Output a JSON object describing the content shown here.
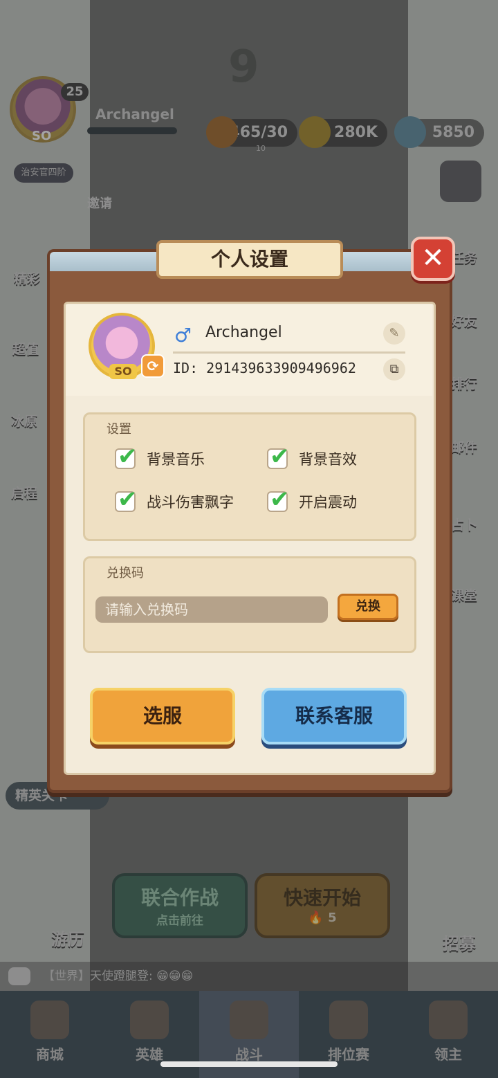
{
  "hud": {
    "level": "25",
    "player_name": "Archangel",
    "avatar_badge": "SO",
    "rank": "治安官四阶",
    "stamina": "465/30",
    "stamina_sub": "10",
    "gold": "280K",
    "crystal": "5850",
    "invite": "邀请",
    "road_number": "9"
  },
  "side_left": [
    "精彩",
    "超值",
    "冰原",
    "启程"
  ],
  "side_right": [
    "任务",
    "好友",
    "排行",
    "邮件",
    "占卜",
    "课堂"
  ],
  "world": {
    "elite_label": "精英关卡",
    "explore_label": "游历",
    "recruit_label": "招募",
    "coop_title": "联合作战",
    "coop_sub": "点击前往",
    "quick_title": "快速开始",
    "quick_cost": "5"
  },
  "chat": {
    "text": "【世界】天使蹬腿登: 😁😁😁"
  },
  "bottom_nav": [
    {
      "label": "商城"
    },
    {
      "label": "英雄"
    },
    {
      "label": "战斗"
    },
    {
      "label": "排位赛"
    },
    {
      "label": "领主"
    }
  ],
  "dialog": {
    "title": "个人设置",
    "close_symbol": "✕",
    "profile": {
      "name": "Archangel",
      "id_text": "ID: 291439633909496962",
      "badge": "SO"
    },
    "settings": {
      "title": "设置",
      "options": [
        {
          "label": "背景音乐",
          "checked": true
        },
        {
          "label": "背景音效",
          "checked": true
        },
        {
          "label": "战斗伤害飘字",
          "checked": true
        },
        {
          "label": "开启震动",
          "checked": true
        }
      ]
    },
    "redeem": {
      "title": "兑换码",
      "placeholder": "请输入兑换码",
      "button": "兑换"
    },
    "buttons": {
      "select_server": "选服",
      "contact_support": "联系客服"
    }
  },
  "colors": {
    "dialog_frame": "#8b5a3d",
    "dialog_inner": "#f3ebda",
    "check_green": "#3cb84a",
    "orange_button": "#f0a33b",
    "blue_button": "#5ea9e2",
    "close_red": "#d44134"
  }
}
